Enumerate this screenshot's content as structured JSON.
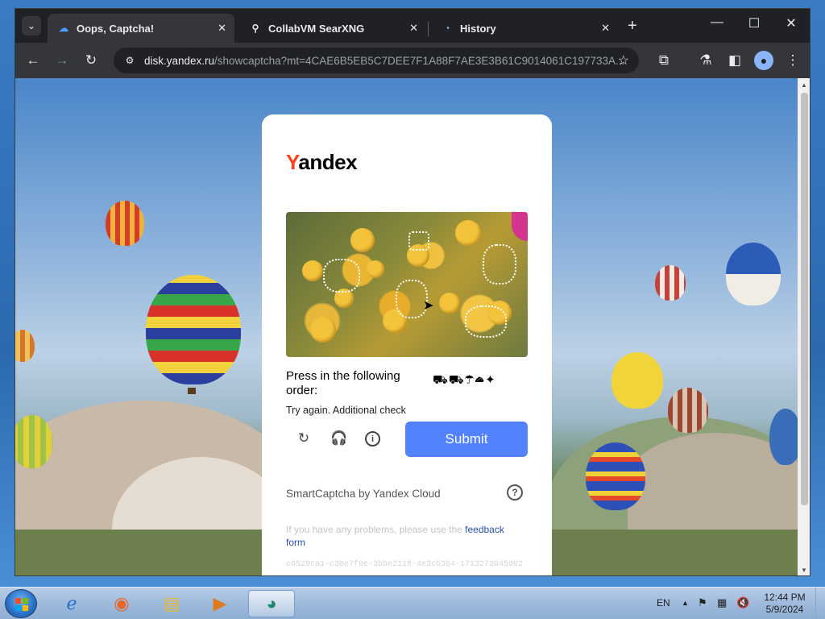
{
  "browser": {
    "tabs": [
      {
        "title": "Oops, Captcha!",
        "icon": "yandex-disk-icon",
        "active": true
      },
      {
        "title": "CollabVM SearXNG",
        "icon": "searxng-icon",
        "active": false
      },
      {
        "title": "History",
        "icon": "history-icon",
        "active": false
      }
    ],
    "close_glyph": "✕",
    "new_tab_glyph": "+",
    "window_controls": {
      "minimize": "—",
      "maximize": "☐",
      "close": "✕"
    },
    "url_domain": "disk.yandex.ru",
    "url_path": "/showcaptcha?mt=4CAE6B5EB5C7DEE7F1A88F7AE3E3B61C9014061C197733A..."
  },
  "captcha": {
    "logo_first": "Y",
    "logo_rest": "andex",
    "instruction": "Press in the following order:",
    "order_icons": "⛟⛟☂☁✦",
    "status": "Try again. Additional check",
    "submit_label": "Submit",
    "provider": "SmartCaptcha by Yandex Cloud",
    "help_glyph": "?",
    "feedback_prefix": "If you have any problems, please use the ",
    "feedback_link": "feedback form",
    "captcha_id": "c6529ca1-c38e7f0e-3bbe2118-4e3c5364-1713273045902"
  },
  "taskbar": {
    "language": "EN",
    "time": "12:44 PM",
    "date": "5/9/2024"
  },
  "colors": {
    "submit_bg": "#5282ff",
    "logo_red": "#fc3f1d",
    "link": "#2b4fb0"
  }
}
